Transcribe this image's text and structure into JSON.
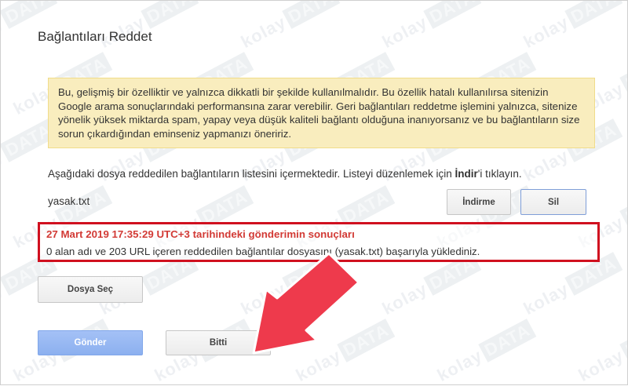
{
  "dialog": {
    "title": "Bağlantıları Reddet",
    "warning_text": "Bu, gelişmiş bir özelliktir ve yalnızca dikkatli bir şekilde kullanılmalıdır. Bu özellik hatalı kullanılırsa sitenizin Google arama sonuçlarındaki performansına zarar verebilir. Geri bağlantıları reddetme işlemini yalnızca, sitenize yönelik yüksek miktarda spam, yapay veya düşük kaliteli bağlantı olduğuna inanıyorsanız ve bu bağlantıların size sorun çıkardığından eminseniz yapmanızı öneririz.",
    "description_prefix": "Aşağıdaki dosya reddedilen bağlantıların listesini içermektedir. Listeyi düzenlemek için ",
    "description_bold": "İndir",
    "description_suffix": "'i tıklayın.",
    "file_name": "yasak.txt",
    "download_label": "İndirme",
    "delete_label": "Sil",
    "result_title": "27 Mart 2019 17:35:29 UTC+3 tarihindeki gönderimin sonuçları",
    "result_text": "0 alan adı ve 203 URL içeren reddedilen bağlantılar dosyasını (yasak.txt) başarıyla yüklediniz.",
    "choose_file_label": "Dosya Seç",
    "submit_label": "Gönder",
    "done_label": "Bitti"
  },
  "watermark": {
    "text": "kolay",
    "box_text": "DATA"
  },
  "colors": {
    "warning_bg": "#f9edbe",
    "highlight_border": "#d0101f",
    "result_title": "#d23a35",
    "submit_bg": "#8cb0ef",
    "arrow": "#ee3a4c"
  }
}
